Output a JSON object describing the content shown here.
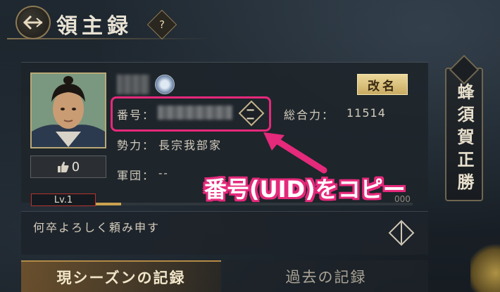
{
  "header": {
    "title": "領主録",
    "help_label": "?"
  },
  "profile": {
    "likes": "0",
    "rename_label": "改名",
    "uid_label": "番号：",
    "total_power_label": "総合力：",
    "total_power_value": "11514",
    "force_label": "勢力：",
    "force_value": "長宗我部家",
    "corps_label": "軍団：",
    "corps_value": "--",
    "level": "Lv.1",
    "level_progress": 0.08,
    "level_end": "000"
  },
  "motto": "何卒よろしく頼み申す",
  "tabs": [
    {
      "label": "現シーズンの記録",
      "active": true
    },
    {
      "label": "過去の記録",
      "active": false
    }
  ],
  "banner": "蜂須賀正勝",
  "annotation": "番号(UID)をコピー",
  "colors": {
    "highlight": "#e5297b",
    "gold": "#c9a24f",
    "rename_button": "#ecd89a"
  },
  "icons": [
    "back-arrow-icon",
    "help-icon",
    "crest-icon",
    "copy-icon",
    "thumbs-up-icon",
    "edit-icon"
  ]
}
